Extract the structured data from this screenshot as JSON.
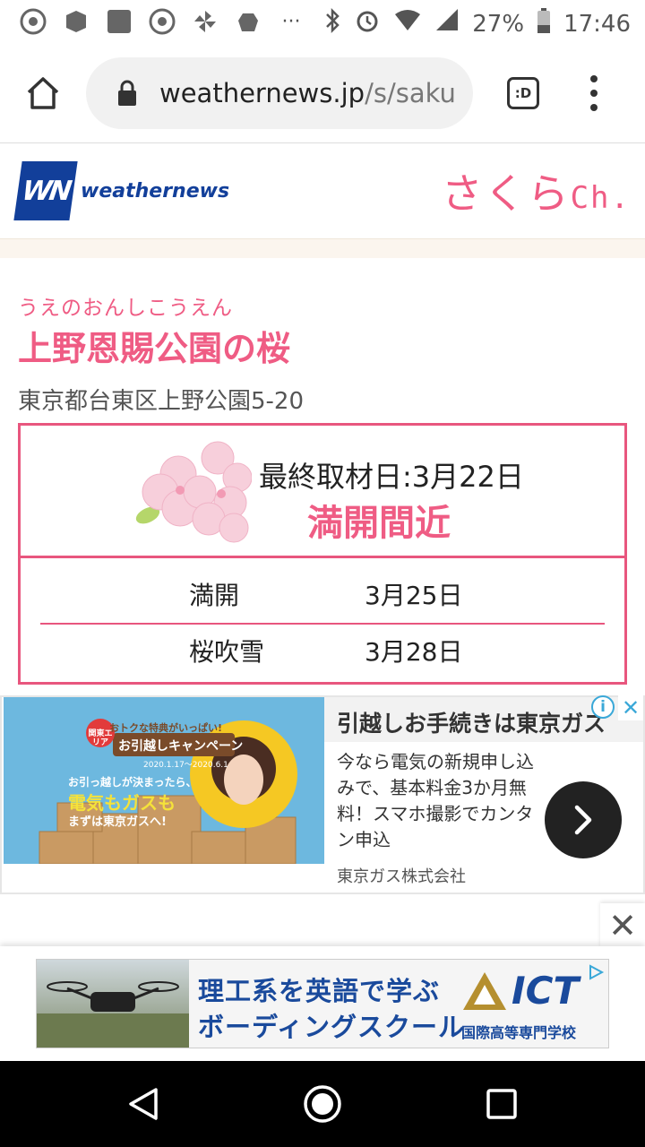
{
  "status_bar": {
    "battery": "27%",
    "time": "17:46",
    "more": "···"
  },
  "browser": {
    "url_host": "weathernews.jp",
    "url_path": "/s/saku",
    "tabs_label": ":D"
  },
  "site": {
    "logo_mark": "WN",
    "logo_text": "weathernews",
    "channel_title": "さくら",
    "channel_suffix": "Ch."
  },
  "spot": {
    "furigana": "うえのおんしこうえん",
    "title": "上野恩賜公園の桜",
    "address": "東京都台東区上野公園5-20"
  },
  "status": {
    "last_report": "最終取材日:3月22日",
    "bloom_status": "満開間近",
    "forecast": [
      {
        "label": "満開",
        "date": "3月25日"
      },
      {
        "label": "桜吹雪",
        "date": "3月28日"
      }
    ]
  },
  "ad1": {
    "title": "引越しお手続きは東京ガス",
    "body": "今なら電気の新規申し込みで、基本料金3か月無料！スマホ撮影でカンタン申込",
    "company": "東京ガス株式会社",
    "image_line1": "おトクな特典がいっぱい!",
    "image_badge": "関東エリア",
    "image_line2": "お引越しキャンペーン",
    "image_dates": "2020.1.17〜2020.6.1",
    "image_line3": "お引っ越しが決まったら、",
    "image_line4": "電気もガスも",
    "image_line5": "まずは東京ガスへ!"
  },
  "ad2": {
    "line1": "理工系を英語で学ぶ",
    "line2": "ボーディングスクール",
    "logo": "ICT",
    "school": "国際高等専門学校"
  },
  "colors": {
    "accent_pink": "#ef5c84",
    "border_pink": "#e8567e",
    "brand_blue": "#123f9a",
    "ad_blue": "#3aa8d8"
  }
}
